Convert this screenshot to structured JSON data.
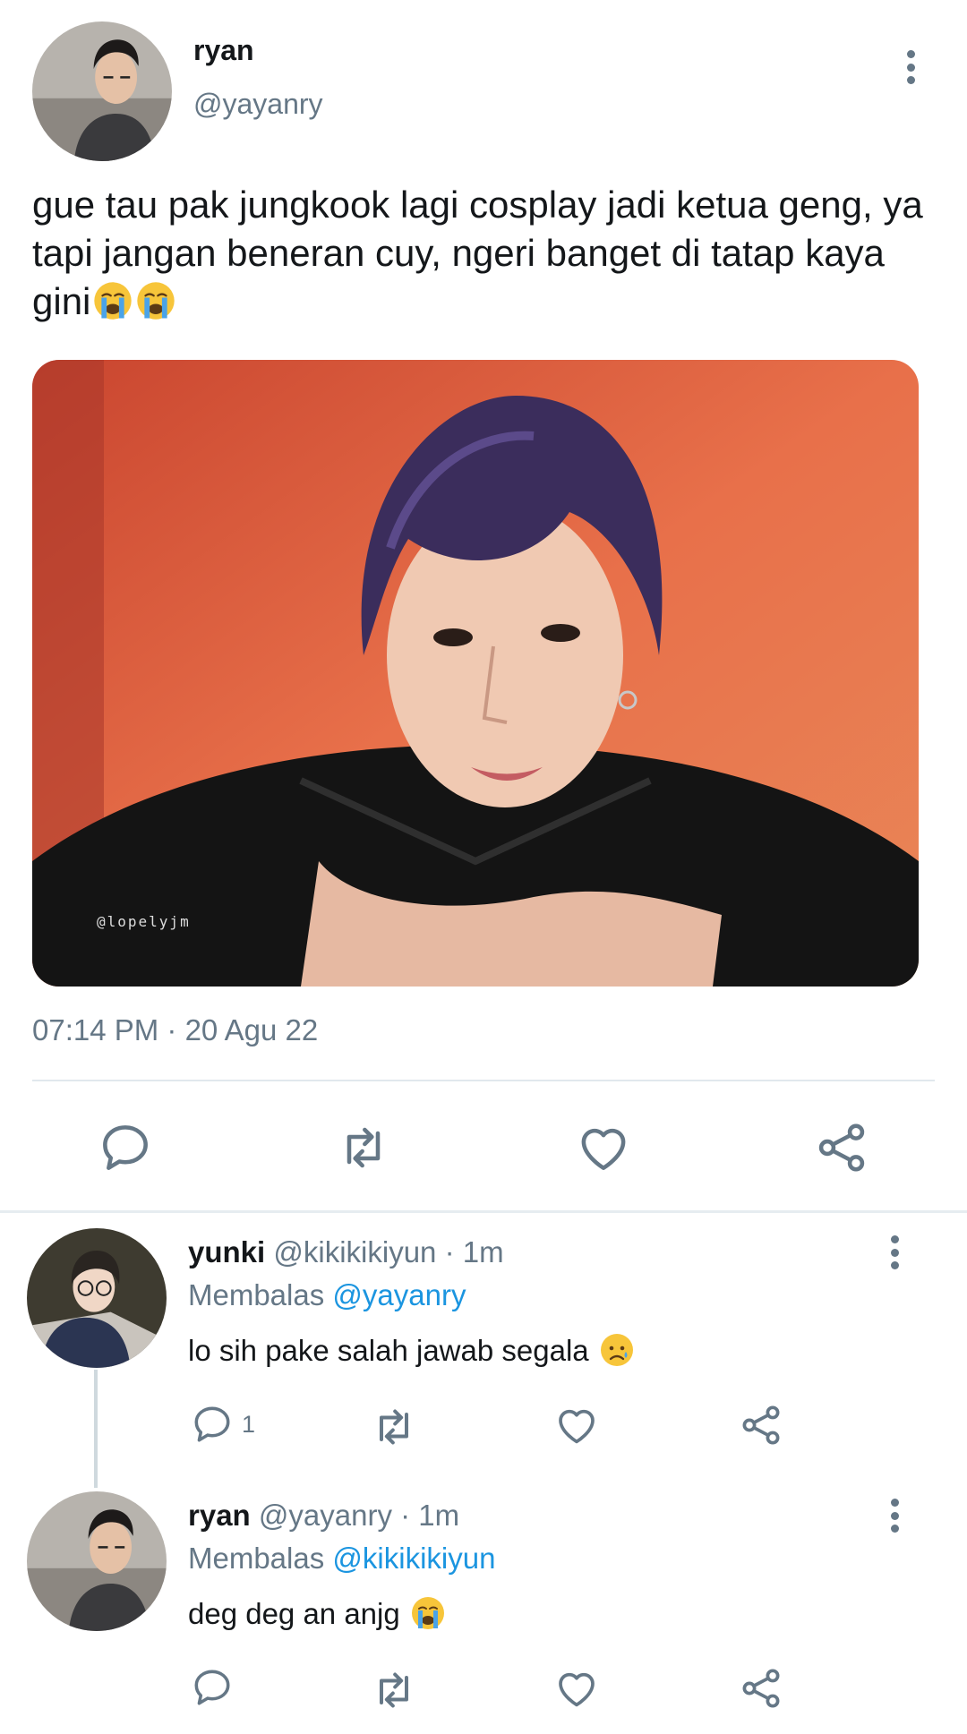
{
  "tweet": {
    "author_name": "ryan",
    "author_handle": "@yayanry",
    "avatar_icon": "user-avatar-photo",
    "text": "gue tau pak jungkook lagi cosplay jadi ketua geng, ya tapi jangan beneran cuy, ngeri banget di tatap kaya gini",
    "text_emoji": [
      "loudly-crying-face",
      "loudly-crying-face"
    ],
    "media_watermark": "@lopelyjm",
    "timestamp": "07:14 PM · 20 Agu 22",
    "actions": [
      "reply-icon",
      "retweet-icon",
      "like-icon",
      "share-icon"
    ]
  },
  "replies": [
    {
      "name": "yunki",
      "handle_time": "@kikikikiyun · 1m",
      "replying_prefix": "Membalas",
      "replying_to": "@yayanry",
      "text": "lo sih pake salah jawab segala",
      "emoji": "sad-face",
      "reply_count": "1"
    },
    {
      "name": "ryan",
      "handle_time": "@yayanry · 1m",
      "replying_prefix": "Membalas",
      "replying_to": "@kikikikiyun",
      "text": "deg deg an anjg",
      "emoji": "loudly-crying-face",
      "reply_count": ""
    }
  ],
  "colors": {
    "text_primary": "#14171a",
    "text_secondary": "#657786",
    "link": "#1b95e0",
    "divider": "#e1e8ed",
    "icon": "#657786"
  }
}
